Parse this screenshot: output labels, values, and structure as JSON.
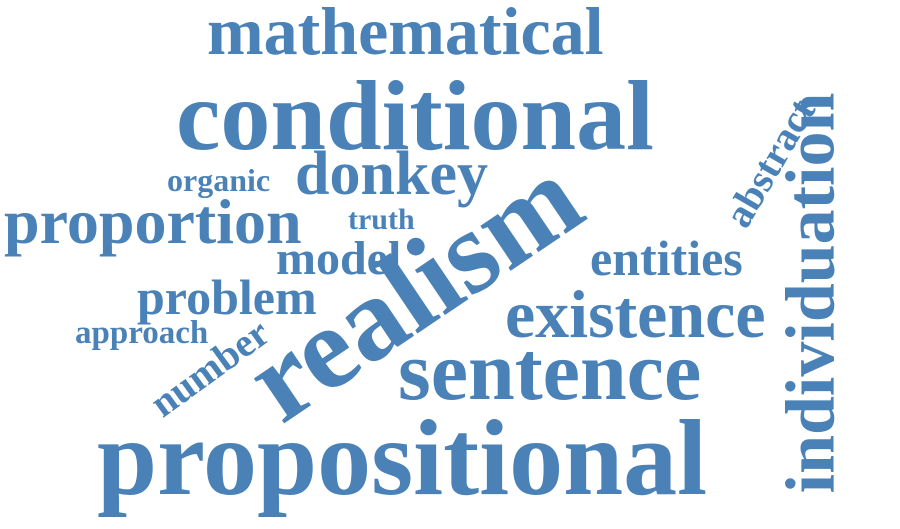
{
  "color": "#4a82b8",
  "words": {
    "mathematical": "mathematical",
    "conditional": "conditional",
    "organic": "organic",
    "donkey": "donkey",
    "proportion": "proportion",
    "truth": "truth",
    "model": "model",
    "problem": "problem",
    "approach": "approach",
    "number": "number",
    "realism": "realism",
    "entities": "entities",
    "abstract": "abstract",
    "existence": "existence",
    "sentence": "sentence",
    "individuation": "individuation",
    "propositional": "propositional"
  }
}
